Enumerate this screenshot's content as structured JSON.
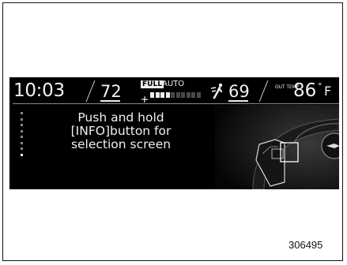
{
  "status_bar": {
    "clock": "10:03",
    "left_temp": "72",
    "fan_mode_badge": "FULL",
    "climate_mode": "AUTO",
    "fan_speed_level": 0.4,
    "right_temp": "69",
    "outside_temp_label": "OUT TEMP",
    "outside_temp_value": "86",
    "outside_temp_degree": "°",
    "outside_temp_unit": "F"
  },
  "page_indicator": {
    "count": 8,
    "active_index": 7
  },
  "message": {
    "line1": "Push and hold",
    "line2": "[INFO]button for",
    "line3": "selection screen"
  },
  "figure_number": "306495",
  "colors": {
    "display_bg": "#000000",
    "text": "#f2f2f2",
    "frame": "#111111"
  },
  "icons": [
    "fan-icon",
    "airflow-icon",
    "steering-wheel-icon"
  ]
}
